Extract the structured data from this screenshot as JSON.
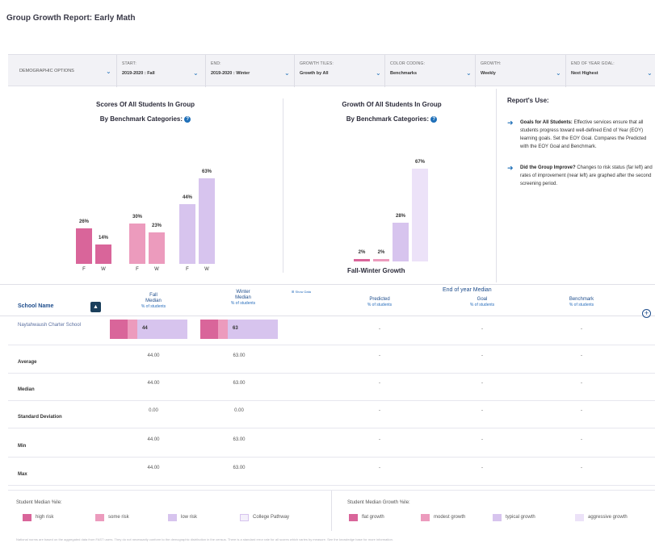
{
  "title": "Group Growth Report: Early Math",
  "filters": {
    "demographic": "DEMOGRAPHIC OPTIONS",
    "start": {
      "label": "START:",
      "value": "2019-2020 : Fall"
    },
    "end": {
      "label": "END:",
      "value": "2019-2020 : Winter"
    },
    "growth_tiles": {
      "label": "GROWTH TILES:",
      "value": "Growth by All"
    },
    "color_coding": {
      "label": "COLOR CODING:",
      "value": "Benchmarks"
    },
    "growth": {
      "label": "GROWTH:",
      "value": "Weekly"
    },
    "eoy_goal": {
      "label": "END OF YEAR GOAL:",
      "value": "Next Highest"
    }
  },
  "scores_panel": {
    "title_line1": "Scores Of All Students In Group",
    "title_line2": "By Benchmark Categories:",
    "help_icon": "question-circle-icon",
    "chart_data": {
      "type": "bar",
      "categories": [
        "F",
        "W",
        "F",
        "W",
        "F",
        "W"
      ],
      "values": [
        26,
        14,
        30,
        23,
        44,
        63
      ],
      "labels": [
        "26%",
        "14%",
        "30%",
        "23%",
        "44%",
        "63%"
      ],
      "colors": [
        "#d9659a",
        "#d9659a",
        "#ec9bbd",
        "#ec9bbd",
        "#d7c4ee",
        "#d7c4ee"
      ],
      "ylim": [
        0,
        70
      ]
    }
  },
  "growth_panel": {
    "title_line1": "Growth Of All Students In Group",
    "title_line2": "By Benchmark Categories:",
    "help_icon": "question-circle-icon",
    "caption": "Fall-Winter Growth",
    "chart_data": {
      "type": "bar",
      "values": [
        2,
        2,
        28,
        67
      ],
      "labels": [
        "2%",
        "2%",
        "28%",
        "67%"
      ],
      "colors": [
        "#d9659a",
        "#ec9bbd",
        "#d7c4ee",
        "#ece2f8"
      ],
      "ylim": [
        0,
        70
      ]
    }
  },
  "uses": {
    "heading": "Report's Use:",
    "items": [
      {
        "bold": "Goals for All Students:",
        "text": " Effective services ensure that all students progress toward well-defined End of Year (EOY) learning goals. Set the EOY Goal. Compares the Predicted with the EOY Goal and Benchmark."
      },
      {
        "bold": "Did the Group Improve?",
        "text": " Changes to risk status (far left) and rates of improvement (near left) are graphed after the second screening period."
      }
    ]
  },
  "table": {
    "school_header": "School Name",
    "sort_icon": "sort-icon",
    "more_data": "Show Data",
    "eoy_header": "End of year Median",
    "columns": [
      {
        "title": "Fall",
        "title2": "Median",
        "sub": "% of students"
      },
      {
        "title": "Winter",
        "title2": "Median",
        "sub": "% of students"
      },
      {
        "title": "Predicted",
        "sub": "% of students"
      },
      {
        "title": "Goal",
        "sub": "% of students"
      },
      {
        "title": "Benchmark",
        "sub": "% of students"
      }
    ],
    "school": {
      "name": "Naytahwaush Charter School",
      "fall_value": "44",
      "fall_segments": [
        26,
        30,
        44
      ],
      "winter_value": "63",
      "winter_segments": [
        14,
        23,
        63
      ],
      "predicted": "-",
      "goal": "-",
      "benchmark": "-"
    },
    "stats": [
      {
        "name": "Average",
        "fall": "44.00",
        "winter": "63.00",
        "predicted": "-",
        "goal": "-",
        "benchmark": "-"
      },
      {
        "name": "Median",
        "fall": "44.00",
        "winter": "63.00",
        "predicted": "-",
        "goal": "-",
        "benchmark": "-"
      },
      {
        "name": "Standard Deviation",
        "fall": "0.00",
        "winter": "0.00",
        "predicted": "-",
        "goal": "-",
        "benchmark": "-"
      },
      {
        "name": "Min",
        "fall": "44.00",
        "winter": "63.00",
        "predicted": "-",
        "goal": "-",
        "benchmark": "-"
      },
      {
        "name": "Max",
        "fall": "44.00",
        "winter": "63.00",
        "predicted": "-",
        "goal": "-",
        "benchmark": "-"
      }
    ]
  },
  "legend_left": {
    "title": "Student Median %ile:",
    "items": [
      {
        "label": "high risk",
        "color": "#d9659a"
      },
      {
        "label": "some risk",
        "color": "#ec9bbd"
      },
      {
        "label": "low risk",
        "color": "#d7c4ee"
      },
      {
        "label": "College Pathway",
        "color": "#f4f0fb"
      }
    ]
  },
  "legend_right": {
    "title": "Student Median Growth %ile:",
    "items": [
      {
        "label": "flat growth",
        "color": "#d9659a"
      },
      {
        "label": "modest growth",
        "color": "#ec9bbd"
      },
      {
        "label": "typical growth",
        "color": "#d7c4ee"
      },
      {
        "label": "aggressive growth",
        "color": "#ece2f8"
      }
    ]
  },
  "footnote": "National norms are based on the aggregated data from FAST users. They do not necessarily conform to the demographic distribution in the census. There is a standard error rate for all scores which varies by measure. See the knowledge base for more information."
}
